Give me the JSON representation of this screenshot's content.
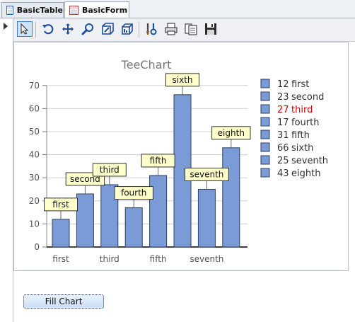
{
  "tabs": [
    {
      "label": "BasicTable",
      "active": false
    },
    {
      "label": "BasicForm",
      "active": true
    }
  ],
  "toolbar": {
    "buttons": [
      "pointer-icon",
      "rotate-icon",
      "move-icon",
      "zoom-icon",
      "3d-icon",
      "depth-icon",
      "edit-icon",
      "print-icon",
      "export-icon",
      "save-icon"
    ]
  },
  "chart_data": {
    "type": "bar",
    "title": "TeeChart",
    "categories": [
      "first",
      "second",
      "third",
      "fourth",
      "fifth",
      "sixth",
      "seventh",
      "eighth"
    ],
    "values": [
      12,
      23,
      27,
      17,
      31,
      66,
      25,
      43
    ],
    "x_tick_labels": [
      "first",
      "third",
      "fifth",
      "seventh"
    ],
    "y_ticks": [
      0,
      10,
      20,
      30,
      40,
      50,
      60,
      70
    ],
    "ylim": [
      0,
      70
    ],
    "grid": true,
    "legend_position": "right",
    "legend_highlight_index": 2,
    "colors": {
      "bar": "#7b9bd6",
      "bar_stroke": "#2f3f5f",
      "label_bg": "#ffffcc",
      "highlight": "#cc0000",
      "grid": "#d0d0d0",
      "title": "#777777"
    }
  },
  "fill_button": {
    "label": "Fill Chart"
  }
}
